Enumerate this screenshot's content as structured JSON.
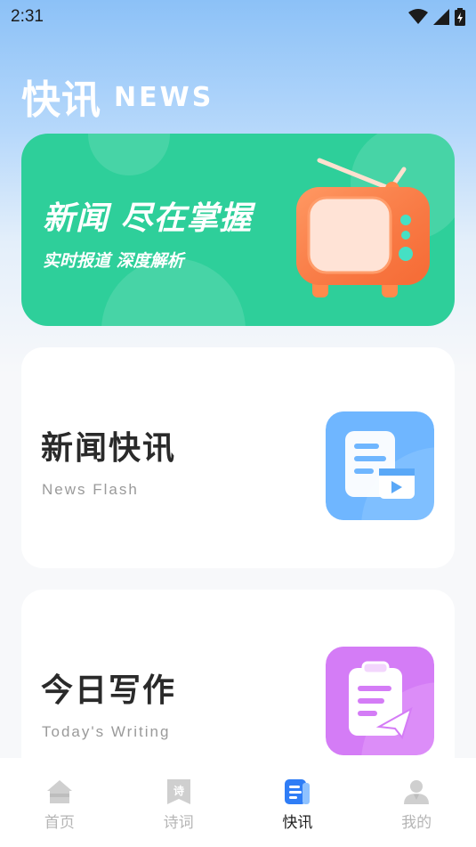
{
  "status_bar": {
    "time": "2:31"
  },
  "header": {
    "title": "快讯",
    "subtitle": "NEWS"
  },
  "banner": {
    "title": "新闻 尽在掌握",
    "subtitle": "实时报道 深度解析"
  },
  "cards": [
    {
      "title": "新闻快讯",
      "subtitle": "News Flash"
    },
    {
      "title": "今日写作",
      "subtitle": "Today's Writing"
    }
  ],
  "tabs": [
    {
      "label": "首页",
      "icon": "home-icon",
      "active": false
    },
    {
      "label": "诗词",
      "icon": "poem-icon",
      "active": false
    },
    {
      "label": "快讯",
      "icon": "news-icon",
      "active": true
    },
    {
      "label": "我的",
      "icon": "profile-icon",
      "active": false
    }
  ],
  "colors": {
    "banner": "#2ecf9a",
    "news_icon": "#6fb6ff",
    "writing_icon": "#d47cf6",
    "tv": "#ff7a3d",
    "active_tab_icon": "#2f7df6"
  }
}
